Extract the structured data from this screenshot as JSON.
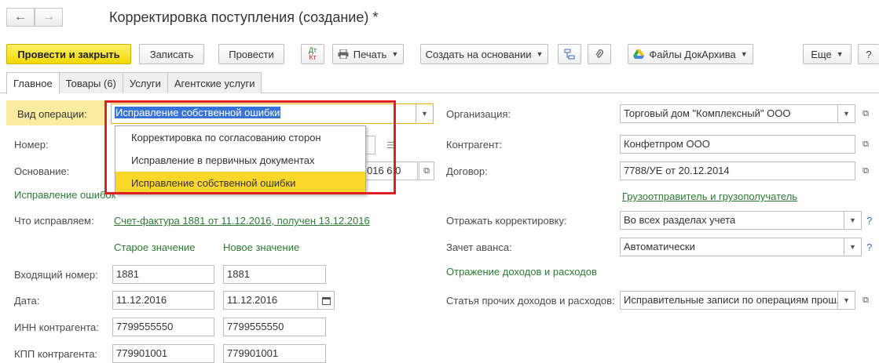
{
  "nav": {
    "back_glyph": "←",
    "forward_glyph": "→"
  },
  "window": {
    "title": "Корректировка поступления (создание) *"
  },
  "toolbar": {
    "post_close": "Провести и закрыть",
    "save": "Записать",
    "post": "Провести",
    "print": "Печать",
    "create_based": "Создать на основании",
    "files": "Файлы ДокАрхива",
    "more": "Еще",
    "help": "?",
    "dtkt_top": "Дт",
    "dtkt_bottom": "Кт"
  },
  "tabs": [
    "Главное",
    "Товары (6)",
    "Услуги",
    "Агентские услуги"
  ],
  "left": {
    "operation_type_label": "Вид операции:",
    "operation_type_value": "Исправление собственной ошибки",
    "number_label": "Номер:",
    "basis_label": "Основание:",
    "basis_value_partial": "016 6:0",
    "correction_link": "Исправление ошибок",
    "what_fix_label": "Что исправляем:",
    "what_fix_value": "Счет-фактура 1881 от 11.12.2016, получен 13.12.2016",
    "old_value_header": "Старое значение",
    "new_value_header": "Новое значение",
    "rows": [
      {
        "label": "Входящий номер:",
        "old": "1881",
        "new": "1881"
      },
      {
        "label": "Дата:",
        "old": "11.12.2016",
        "new": "11.12.2016"
      },
      {
        "label": "ИНН контрагента:",
        "old": "7799555550",
        "new": "7799555550"
      },
      {
        "label": "КПП контрагента:",
        "old": "779901001",
        "new": "779901001"
      }
    ]
  },
  "dropdown": {
    "items": [
      "Корректировка по согласованию сторон",
      "Исправление в первичных документах",
      "Исправление собственной ошибки"
    ],
    "selected_index": 2
  },
  "right": {
    "org_label": "Организация:",
    "org_value": "Торговый дом \"Комплексный\" ООО",
    "counterparty_label": "Контрагент:",
    "counterparty_value": "Конфетпром ООО",
    "contract_label": "Договор:",
    "contract_value": "7788/УЕ от 20.12.2014",
    "shipper_link": "Грузоотправитель и грузополучатель",
    "reflect_label": "Отражать корректировку:",
    "reflect_value": "Во всех разделах учета",
    "advance_label": "Зачет аванса:",
    "advance_value": "Автоматически",
    "income_expense_heading": "Отражение доходов и расходов",
    "other_items_label": "Статья прочих доходов и расходов:",
    "other_items_value": "Исправительные записи по операциям прошл"
  },
  "colors": {
    "accent_yellow": "#f2d900",
    "highlight_red": "#e02020",
    "link_green": "#2d7a33"
  }
}
